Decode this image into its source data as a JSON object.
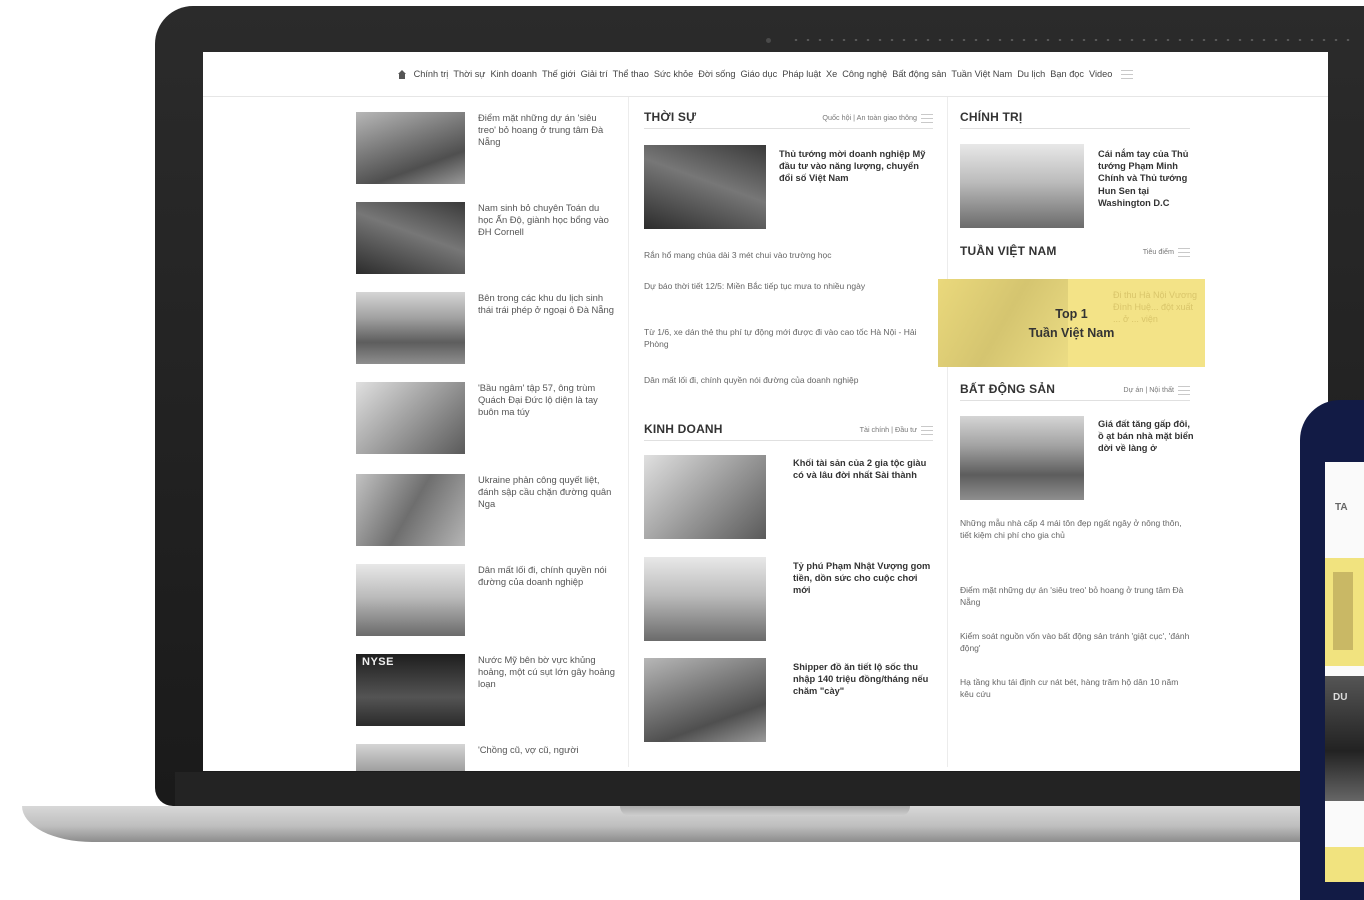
{
  "nav": {
    "items": [
      "Chính trị",
      "Thời sự",
      "Kinh doanh",
      "Thế giới",
      "Giải trí",
      "Thể thao",
      "Sức khỏe",
      "Đời sống",
      "Giáo dục",
      "Pháp luật",
      "Xe",
      "Công nghệ",
      "Bất động sản",
      "Tuần Việt Nam",
      "Du lịch",
      "Bạn đọc",
      "Video"
    ]
  },
  "left": [
    {
      "title": "Điểm mặt những dự án 'siêu treo' bỏ hoang ở trung tâm Đà Nẵng"
    },
    {
      "title": "Nam sinh bỏ chuyên Toán du học Ấn Độ, giành học bổng vào ĐH Cornell"
    },
    {
      "title": "Bên trong các khu du lịch sinh thái trái phép ở ngoại ô Đà Nẵng"
    },
    {
      "title": "'Bầu ngâm' tập 57, ông trùm Quách Đại Đức lộ diện là tay buôn ma túy"
    },
    {
      "title": "Ukraine phản công quyết liệt, đánh sập cầu chặn đường quân Nga"
    },
    {
      "title": "Dân mất lối đi, chính quyền nói đường của doanh nghiệp"
    },
    {
      "title": "Nước Mỹ bên bờ vực khủng hoảng, một cú sụt lớn gây hoảng loạn",
      "image_text": "NYSE"
    },
    {
      "title": "'Chồng cũ, vợ cũ, người"
    }
  ],
  "thoisu": {
    "title": "THỜI SỰ",
    "sub": "Quốc hội  |  An toàn giao thông",
    "feature_title": "Thủ tướng mời doanh nghiệp Mỹ đầu tư vào năng lượng, chuyển đổi số Việt Nam",
    "links": [
      "Rắn hổ mang chúa dài 3 mét chui vào trường học",
      "Dự báo thời tiết 12/5: Miền Bắc tiếp tục mưa to nhiều ngày",
      "Từ 1/6, xe dán thẻ thu phí tự động mới được đi vào cao tốc Hà Nội - Hải Phòng",
      "Dân mất lối đi, chính quyền nói đường của doanh nghiệp"
    ]
  },
  "kinhdoanh": {
    "title": "KINH DOANH",
    "sub": "Tài chính  |  Đầu tư",
    "items": [
      {
        "title": "Khối tài sản của 2 gia tộc giàu có và lâu đời nhất Sài thành"
      },
      {
        "title": "Tỷ phú Phạm Nhật Vượng gom tiền, dồn sức cho cuộc chơi mới"
      },
      {
        "title": "Shipper đồ ăn tiết lộ sốc thu nhập 140 triệu đồng/tháng nếu chăm \"cày\""
      }
    ]
  },
  "chinhtri": {
    "title": "CHÍNH TRỊ",
    "feature_title": "Cái nắm tay của Thủ tướng Phạm Minh Chính và Thủ tướng Hun Sen tại Washington D.C"
  },
  "tuanvietnam": {
    "title": "TUẦN VIỆT NAM",
    "sub": "Tiêu điểm",
    "banner_top": "Top 1",
    "banner_name": "Tuần Việt Nam",
    "banner_faint": "Đi thu Hà Nội Vương Đình Huệ... đột xuất ... ở ... viện"
  },
  "batdongsan": {
    "title": "BẤT ĐỘNG SẢN",
    "sub": "Dự án  |  Nội thất",
    "feature_title": "Giá đất tăng gấp đôi, ồ ạt bán nhà mặt biển dời về làng ở",
    "links": [
      "Những mẫu nhà cấp 4 mái tôn đẹp ngất ngây ở nông thôn, tiết kiệm chi phí cho gia chủ",
      "Điểm mặt những dự án 'siêu treo' bỏ hoang ở trung tâm Đà Nẵng",
      "Kiểm soát nguồn vốn vào bất động sản tránh 'giật cục', 'đánh động'",
      "Hạ tầng khu tái định cư nát bét, hàng trăm hộ dân 10 năm kêu cứu"
    ]
  },
  "phone": {
    "head": "TA",
    "dark_text": "DU"
  }
}
